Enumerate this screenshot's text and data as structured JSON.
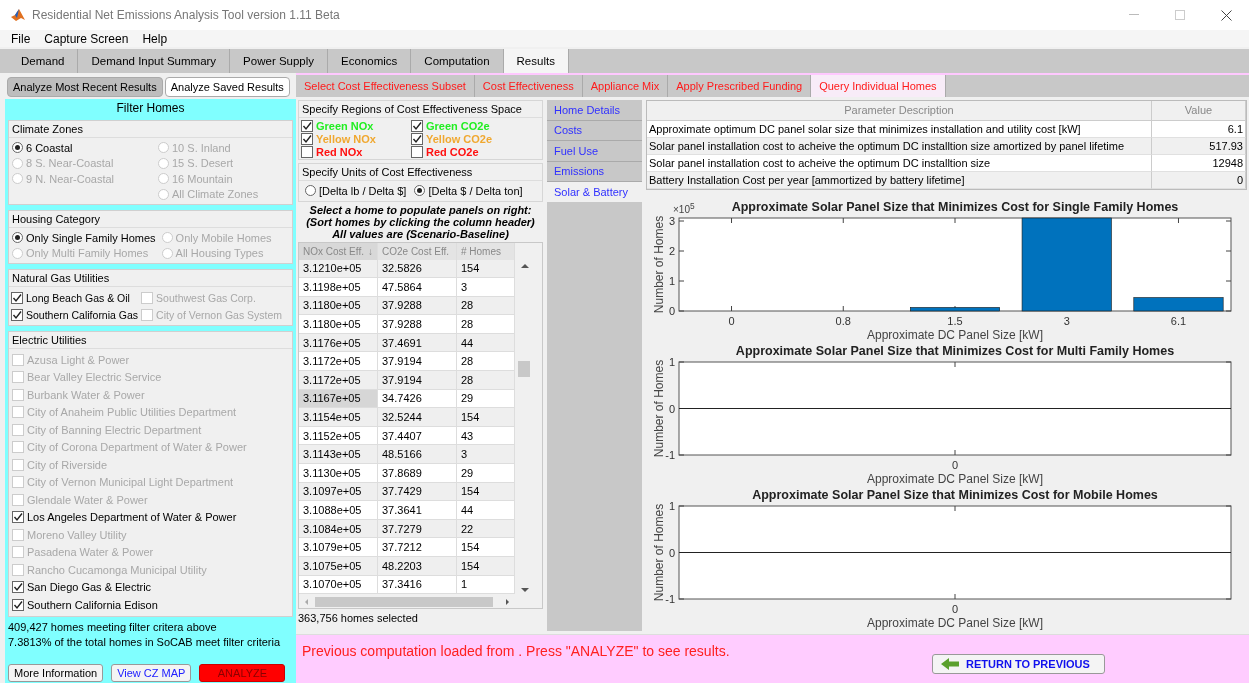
{
  "window": {
    "title": "Residential Net Emissions Analysis Tool version 1.11 Beta"
  },
  "menu": [
    "File",
    "Capture Screen",
    "Help"
  ],
  "tabs": [
    {
      "label": "Demand",
      "selected": false
    },
    {
      "label": "Demand Input Summary",
      "selected": false
    },
    {
      "label": "Power Supply",
      "selected": false
    },
    {
      "label": "Economics",
      "selected": false
    },
    {
      "label": "Computation",
      "selected": false
    },
    {
      "label": "Results",
      "selected": true
    }
  ],
  "left_panel": {
    "mode_buttons": [
      {
        "label": "Analyze Most Recent Results",
        "selected": true
      },
      {
        "label": "Analyze Saved Results",
        "selected": false
      }
    ],
    "header": "Filter Homes",
    "climate_zones": {
      "title": "Climate Zones",
      "columns": [
        [
          {
            "label": "6  Coastal",
            "selected": true,
            "disabled": false
          },
          {
            "label": "8  S. Near-Coastal",
            "selected": false,
            "disabled": true
          },
          {
            "label": "9  N. Near-Coastal",
            "selected": false,
            "disabled": true
          }
        ],
        [
          {
            "label": "10  S. Inland",
            "selected": false,
            "disabled": true
          },
          {
            "label": "15  S. Desert",
            "selected": false,
            "disabled": true
          },
          {
            "label": "16  Mountain",
            "selected": false,
            "disabled": true
          },
          {
            "label": "All Climate Zones",
            "selected": false,
            "disabled": true
          }
        ]
      ]
    },
    "housing_category": {
      "title": "Housing Category",
      "columns": [
        [
          {
            "label": "Only Single Family Homes",
            "selected": true,
            "disabled": false
          },
          {
            "label": "Only Multi Family Homes",
            "selected": false,
            "disabled": true
          }
        ],
        [
          {
            "label": "Only Mobile Homes",
            "selected": false,
            "disabled": true
          },
          {
            "label": "All Housing Types",
            "selected": false,
            "disabled": true
          }
        ]
      ]
    },
    "natural_gas_utilities": {
      "title": "Natural Gas Utilities",
      "columns": [
        [
          {
            "label": "Long Beach Gas & Oil",
            "checked": true,
            "disabled": false
          },
          {
            "label": "Southern California Gas",
            "checked": true,
            "disabled": false
          }
        ],
        [
          {
            "label": "Southwest Gas Corp.",
            "checked": false,
            "disabled": true
          },
          {
            "label": "City of Vernon Gas System",
            "checked": false,
            "disabled": true
          }
        ]
      ]
    },
    "electric_utilities": {
      "title": "Electric Utilities",
      "items": [
        {
          "label": "Azusa Light & Power",
          "checked": false,
          "disabled": true
        },
        {
          "label": "Bear Valley Electric Service",
          "checked": false,
          "disabled": true
        },
        {
          "label": "Burbank Water & Power",
          "checked": false,
          "disabled": true
        },
        {
          "label": "City of Anaheim Public Utilities Department",
          "checked": false,
          "disabled": true
        },
        {
          "label": "City of Banning Electric Department",
          "checked": false,
          "disabled": true
        },
        {
          "label": "City of Corona Department of Water & Power",
          "checked": false,
          "disabled": true
        },
        {
          "label": "City of Riverside",
          "checked": false,
          "disabled": true
        },
        {
          "label": "City of Vernon Municipal Light Department",
          "checked": false,
          "disabled": true
        },
        {
          "label": "Glendale Water & Power",
          "checked": false,
          "disabled": true
        },
        {
          "label": "Los Angeles Department of Water & Power",
          "checked": true,
          "disabled": false
        },
        {
          "label": "Moreno Valley Utility",
          "checked": false,
          "disabled": true
        },
        {
          "label": "Pasadena Water & Power",
          "checked": false,
          "disabled": true
        },
        {
          "label": "Rancho Cucamonga Municipal Utility",
          "checked": false,
          "disabled": true
        },
        {
          "label": "San Diego Gas & Electric",
          "checked": true,
          "disabled": false
        },
        {
          "label": "Southern California Edison",
          "checked": true,
          "disabled": false
        }
      ]
    },
    "summary": [
      "409,427 homes meeting filter critera above",
      "7.3813% of the total homes in SoCAB meet filter criteria"
    ],
    "buttons": [
      {
        "label": "More Information",
        "kind": "plain"
      },
      {
        "label": "View CZ MAP",
        "kind": "link"
      },
      {
        "label": "ANALYZE",
        "kind": "primary"
      }
    ]
  },
  "subtabs": [
    {
      "label": "Select Cost Effectiveness Subset",
      "selected": false
    },
    {
      "label": "Cost Effectiveness",
      "selected": false
    },
    {
      "label": "Appliance Mix",
      "selected": false
    },
    {
      "label": "Apply Prescribed Funding",
      "selected": false
    },
    {
      "label": "Query Individual Homes",
      "selected": true
    }
  ],
  "regions": {
    "title": "Specify Regions of Cost Effectiveness Space",
    "items": [
      {
        "label": "Green NOx",
        "checked": true,
        "color": "#22ee22"
      },
      {
        "label": "Green CO2e",
        "checked": true,
        "color": "#22ee22"
      },
      {
        "label": "Yellow NOx",
        "checked": true,
        "color": "#f0a830"
      },
      {
        "label": "Yellow CO2e",
        "checked": true,
        "color": "#f0a830"
      },
      {
        "label": "Red NOx",
        "checked": false,
        "color": "#ff1010"
      },
      {
        "label": "Red CO2e",
        "checked": false,
        "color": "#ff1010"
      }
    ]
  },
  "units": {
    "title": "Specify Units of Cost Effectiveness",
    "options": [
      {
        "label": "[Delta lb / Delta $]",
        "selected": false
      },
      {
        "label": "[Delta $ / Delta ton]",
        "selected": true
      }
    ]
  },
  "instructions": [
    "Select a home to populate panels on right:",
    "(Sort homes by clicking the column header)",
    "All values are (Scenario-Baseline)"
  ],
  "table": {
    "columns": [
      {
        "label": "NOx Cost Eff.",
        "sort": "↓"
      },
      {
        "label": "CO2e Cost Eff."
      },
      {
        "label": "# Homes"
      }
    ],
    "rows": [
      {
        "cells": [
          "3.1210e+05",
          "32.5826",
          "154"
        ],
        "selected": false
      },
      {
        "cells": [
          "3.1198e+05",
          "47.5864",
          "3"
        ],
        "selected": false
      },
      {
        "cells": [
          "3.1180e+05",
          "37.9288",
          "28"
        ],
        "selected": false
      },
      {
        "cells": [
          "3.1180e+05",
          "37.9288",
          "28"
        ],
        "selected": false
      },
      {
        "cells": [
          "3.1176e+05",
          "37.4691",
          "44"
        ],
        "selected": false
      },
      {
        "cells": [
          "3.1172e+05",
          "37.9194",
          "28"
        ],
        "selected": false
      },
      {
        "cells": [
          "3.1172e+05",
          "37.9194",
          "28"
        ],
        "selected": false
      },
      {
        "cells": [
          "3.1167e+05",
          "34.7426",
          "29"
        ],
        "selected": true
      },
      {
        "cells": [
          "3.1154e+05",
          "32.5244",
          "154"
        ],
        "selected": false
      },
      {
        "cells": [
          "3.1152e+05",
          "37.4407",
          "43"
        ],
        "selected": false
      },
      {
        "cells": [
          "3.1143e+05",
          "48.5166",
          "3"
        ],
        "selected": false
      },
      {
        "cells": [
          "3.1130e+05",
          "37.8689",
          "29"
        ],
        "selected": false
      },
      {
        "cells": [
          "3.1097e+05",
          "37.7429",
          "154"
        ],
        "selected": false
      },
      {
        "cells": [
          "3.1088e+05",
          "37.3641",
          "44"
        ],
        "selected": false
      },
      {
        "cells": [
          "3.1084e+05",
          "37.7279",
          "22"
        ],
        "selected": false
      },
      {
        "cells": [
          "3.1079e+05",
          "37.7212",
          "154"
        ],
        "selected": false
      },
      {
        "cells": [
          "3.1075e+05",
          "48.2203",
          "154"
        ],
        "selected": false
      },
      {
        "cells": [
          "3.1070e+05",
          "37.3416",
          "1"
        ],
        "selected": false
      }
    ]
  },
  "selection_count": "363,756 homes selected",
  "side_tabs": [
    {
      "label": "Home Details",
      "selected": false
    },
    {
      "label": "Costs",
      "selected": false
    },
    {
      "label": "Fuel Use",
      "selected": false
    },
    {
      "label": "Emissions",
      "selected": false
    },
    {
      "label": "Solar & Battery",
      "selected": true
    }
  ],
  "parameters": {
    "columns": [
      "Parameter Description",
      "Value"
    ],
    "rows": [
      [
        "Approximate optimum DC panel solar size that minimizes installation and utility cost [kW]",
        "6.1"
      ],
      [
        "Solar panel installation cost to acheive the optimum DC installtion size amortized by panel lifetime",
        "517.93"
      ],
      [
        "Solar panel installation cost to acheive the optimum DC installtion size",
        "12948"
      ],
      [
        "Battery Installation Cost per year [ammortized by battery lifetime]",
        "0"
      ]
    ]
  },
  "charts": [
    {
      "chart_data": {
        "type": "bar",
        "title": "Approximate Solar Panel Size that Minimizes Cost for Single Family Homes",
        "xlabel": "Approximate DC Panel Size [kW]",
        "ylabel": "Number of Homes",
        "categories": [
          "0",
          "0.8",
          "1.5",
          "3",
          "6.1"
        ],
        "values": [
          0,
          0,
          0.12,
          3.1,
          0.45
        ],
        "ylim": [
          0,
          3.1
        ],
        "yticks": [
          0,
          1,
          2,
          3
        ],
        "annotations": [
          {
            "text": "×10$^{5}$"
          }
        ]
      }
    },
    {
      "chart_data": {
        "type": "bar",
        "title": "Approximate Solar Panel Size that Minimizes Cost for Multi Family Homes",
        "xlabel": "Approximate DC Panel Size [kW]",
        "ylabel": "Number of Homes",
        "categories": [
          "0"
        ],
        "values": [
          0
        ],
        "ylim": [
          -1,
          1
        ],
        "yticks": [
          -1,
          0,
          1
        ]
      }
    },
    {
      "chart_data": {
        "type": "bar",
        "title": "Approximate Solar Panel Size that Minimizes Cost for Mobile Homes",
        "xlabel": "Approximate DC Panel Size [kW]",
        "ylabel": "Number of Homes",
        "categories": [
          "0"
        ],
        "values": [
          0
        ],
        "ylim": [
          -1,
          1
        ],
        "yticks": [
          -1,
          0,
          1
        ]
      }
    }
  ],
  "footer": {
    "message": "Previous computation loaded from . Press \"ANALYZE\" to see results.",
    "button": "RETURN TO PREVIOUS"
  }
}
